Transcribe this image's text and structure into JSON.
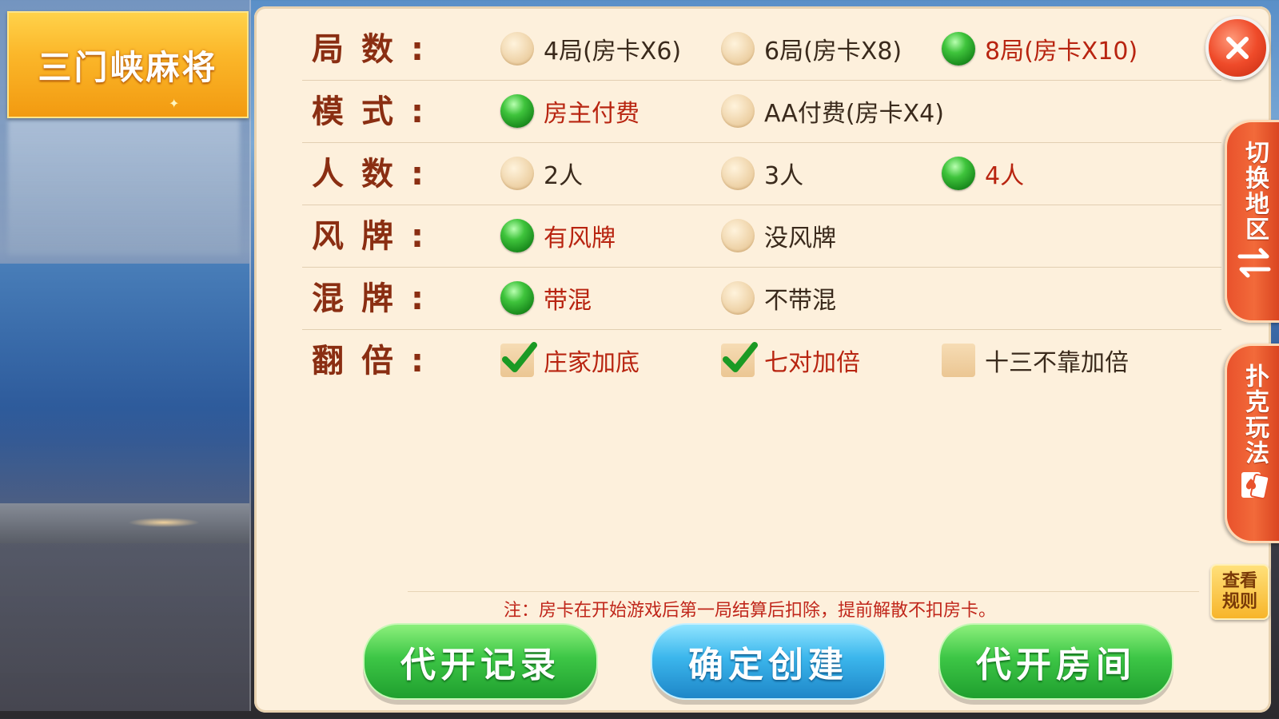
{
  "game_title": "三门峡麻将",
  "rows": [
    {
      "label": "局数:",
      "type": "radio",
      "options": [
        {
          "text": "4局(房卡X6)",
          "selected": false
        },
        {
          "text": "6局(房卡X8)",
          "selected": false
        },
        {
          "text": "8局(房卡X10)",
          "selected": true
        }
      ]
    },
    {
      "label": "模式:",
      "type": "radio",
      "options": [
        {
          "text": "房主付费",
          "selected": true
        },
        {
          "text": "AA付费(房卡X4)",
          "selected": false
        }
      ]
    },
    {
      "label": "人数:",
      "type": "radio",
      "options": [
        {
          "text": "2人",
          "selected": false
        },
        {
          "text": "3人",
          "selected": false
        },
        {
          "text": "4人",
          "selected": true
        }
      ]
    },
    {
      "label": "风牌:",
      "type": "radio",
      "options": [
        {
          "text": "有风牌",
          "selected": true
        },
        {
          "text": "没风牌",
          "selected": false
        }
      ]
    },
    {
      "label": "混牌:",
      "type": "radio",
      "options": [
        {
          "text": "带混",
          "selected": true
        },
        {
          "text": "不带混",
          "selected": false
        }
      ]
    },
    {
      "label": "翻倍:",
      "type": "checkbox",
      "options": [
        {
          "text": "庄家加底",
          "selected": true
        },
        {
          "text": "七对加倍",
          "selected": true
        },
        {
          "text": "十三不靠加倍",
          "selected": false
        }
      ]
    }
  ],
  "side_tabs": {
    "switch_region": "切换地区",
    "poker_play": "扑克玩法"
  },
  "rules_button": "查看规则",
  "note": "注：房卡在开始游戏后第一局结算后扣除，提前解散不扣房卡。",
  "buttons": {
    "proxy_records": "代开记录",
    "confirm_create": "确定创建",
    "proxy_room": "代开房间"
  },
  "colors": {
    "label": "#8a2e12",
    "selected_text": "#b82410",
    "radio_on": "#3fc43c",
    "dialog_bg": "#fdf0dc"
  }
}
